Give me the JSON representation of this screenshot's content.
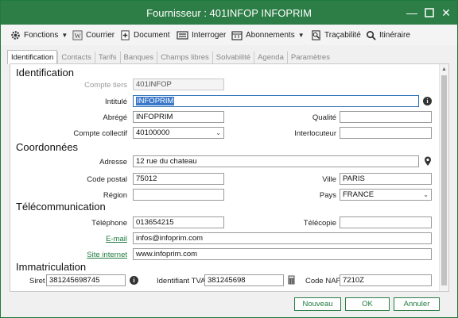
{
  "window": {
    "title": "Fournisseur : 401INFOP INFOPRIM"
  },
  "toolbar": {
    "fonctions": "Fonctions",
    "courrier": "Courrier",
    "document": "Document",
    "interroger": "Interroger",
    "abonnements": "Abonnements",
    "tracabilite": "Traçabilité",
    "itineraire": "Itinéraire"
  },
  "tabs": [
    "Identification",
    "Contacts",
    "Tarifs",
    "Banques",
    "Champs libres",
    "Solvabilité",
    "Agenda",
    "Paramètres"
  ],
  "identification": {
    "section": "Identification",
    "compte_tiers_label": "Compte tiers",
    "compte_tiers_value": "401INFOP",
    "intitule_label": "Intitulé",
    "intitule_value": "INFOPRIM",
    "abrege_label": "Abrégé",
    "abrege_value": "INFOPRIM",
    "qualite_label": "Qualité",
    "qualite_value": "",
    "compte_collectif_label": "Compte collectif",
    "compte_collectif_value": "40100000",
    "interlocuteur_label": "Interlocuteur",
    "interlocuteur_value": ""
  },
  "coordonnees": {
    "section": "Coordonnées",
    "adresse_label": "Adresse",
    "adresse_value": "12 rue du chateau",
    "code_postal_label": "Code postal",
    "code_postal_value": "75012",
    "ville_label": "Ville",
    "ville_value": "PARIS",
    "region_label": "Région",
    "region_value": "",
    "pays_label": "Pays",
    "pays_value": "FRANCE"
  },
  "telecom": {
    "section": "Télécommunication",
    "telephone_label": "Téléphone",
    "telephone_value": "013654215",
    "telecopie_label": "Télécopie",
    "telecopie_value": "",
    "email_label": "E-mail",
    "email_value": "infos@infoprim.com",
    "site_label": "Site internet",
    "site_value": "www.infoprim.com"
  },
  "immatriculation": {
    "section": "Immatriculation",
    "siret_label": "Siret",
    "siret_value": "381245698745",
    "tva_label": "Identifiant TVA",
    "tva_value": "381245698",
    "naf_label": "Code NAF",
    "naf_value": "7210Z"
  },
  "footer": {
    "nouveau": "Nouveau",
    "ok": "OK",
    "annuler": "Annuler"
  },
  "colors": {
    "accent": "#2d7d46",
    "selection": "#3a78c9"
  },
  "icons": [
    "gear-icon",
    "word-icon",
    "document-add-icon",
    "keyboard-icon",
    "calendar-icon",
    "traceability-icon",
    "search-icon",
    "info-icon",
    "map-pin-icon",
    "calculator-icon"
  ]
}
